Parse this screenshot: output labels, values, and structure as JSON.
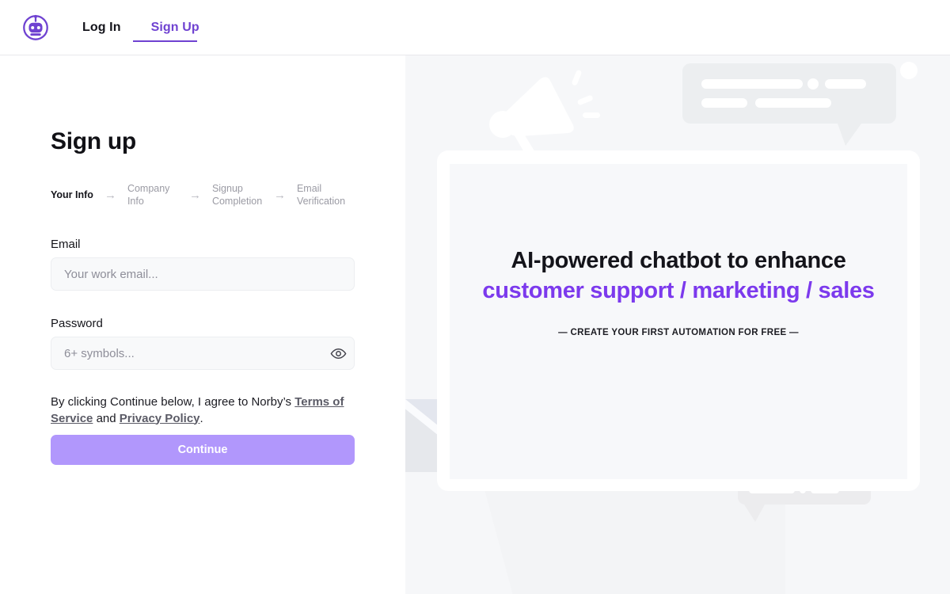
{
  "brand": {
    "logo_icon": "robot-logo-icon",
    "name": "Norby"
  },
  "nav": {
    "login_label": "Log In",
    "signup_label": "Sign Up",
    "active": "Sign Up"
  },
  "form": {
    "title": "Sign up",
    "steps": [
      {
        "label": "Your Info",
        "active": true
      },
      {
        "label": "Company Info",
        "active": false
      },
      {
        "label": "Signup Completion",
        "active": false
      },
      {
        "label": "Email Verification",
        "active": false
      }
    ],
    "step_arrow": "→",
    "email": {
      "label": "Email",
      "placeholder": "Your work email...",
      "value": ""
    },
    "password": {
      "label": "Password",
      "placeholder": "6+ symbols...",
      "value": "",
      "toggle_icon": "eye-icon"
    },
    "terms": {
      "prefix": "By clicking Continue below, I agree to Norby’s",
      "terms_link": "Terms of Service",
      "conjunction": "and",
      "privacy_link": "Privacy Policy",
      "suffix": "."
    },
    "continue_label": "Continue"
  },
  "hero": {
    "line1": "AI-powered chatbot to enhance",
    "line2": "customer support / marketing / sales",
    "subtitle": "— CREATE YOUR FIRST AUTOMATION FOR FREE —"
  },
  "colors": {
    "accent_purple": "#6f42d1",
    "hero_purple": "#7c3aed",
    "button_purple": "#b197fc",
    "panel_bg": "#f6f7f9"
  }
}
